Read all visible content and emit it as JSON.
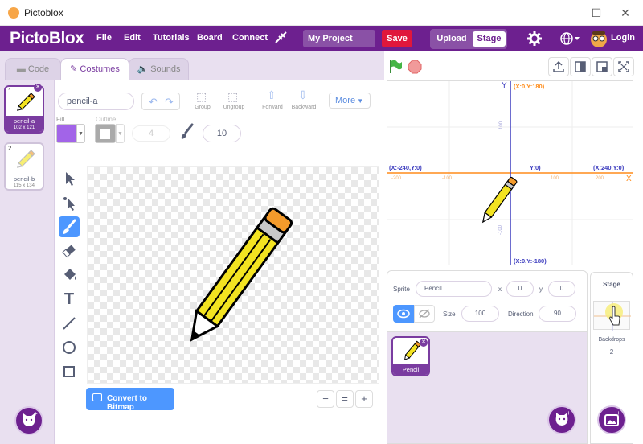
{
  "window": {
    "title": "Pictoblox",
    "minimize": "–",
    "maximize": "☐",
    "close": "✕"
  },
  "menubar": {
    "logo": "PictoBlox",
    "items": [
      "File",
      "Edit",
      "Tutorials",
      "Board",
      "Connect"
    ],
    "project_name": "My Project",
    "save": "Save",
    "upload": "Upload",
    "stage": "Stage",
    "login": "Login"
  },
  "tabs": {
    "code": "Code",
    "costumes": "Costumes",
    "sounds": "Sounds"
  },
  "costumes": [
    {
      "num": "1",
      "name": "pencil-a",
      "size": "102 x 121"
    },
    {
      "num": "2",
      "name": "pencil-b",
      "size": "115 x 134"
    }
  ],
  "editor": {
    "costume_name": "pencil-a",
    "group": "Group",
    "ungroup": "Ungroup",
    "forward": "Forward",
    "backward": "Backward",
    "more": "More",
    "fill_label": "Fill",
    "outline_label": "Outline",
    "outline_width": "4",
    "brush_size": "10",
    "convert": "Convert to Bitmap",
    "zoom_out": "−",
    "zoom_reset": "=",
    "zoom_in": "+",
    "fill_color": "#a264e8"
  },
  "stage": {
    "y_axis": "Y",
    "x_axis": "X",
    "top_label": "(X:0,Y:180)",
    "bottom_label": "(X:0,Y:-180)",
    "left_label": "(X:-240,Y:0)",
    "right_label": "(X:240,Y:0)",
    "origin_label": "Y:0)",
    "ticks_x": [
      "-200",
      "-100",
      "100",
      "200"
    ],
    "ticks_y": [
      "100",
      "-100"
    ]
  },
  "sprite": {
    "label": "Sprite",
    "name": "Pencil",
    "x_label": "x",
    "x": "0",
    "y_label": "y",
    "y": "0",
    "size_label": "Size",
    "size": "100",
    "direction_label": "Direction",
    "direction": "90",
    "show_label": "Show"
  },
  "sprite_list": [
    {
      "name": "Pencil"
    }
  ],
  "stage_panel": {
    "title": "Stage",
    "backdrops_label": "Backdrops",
    "backdrops_count": "2"
  },
  "colors": {
    "brand": "#6d208f",
    "save": "#e0173c",
    "accent": "#4d97ff",
    "stage_axis": "#ff8c1a",
    "stage_y_axis": "#3d3dbf"
  }
}
